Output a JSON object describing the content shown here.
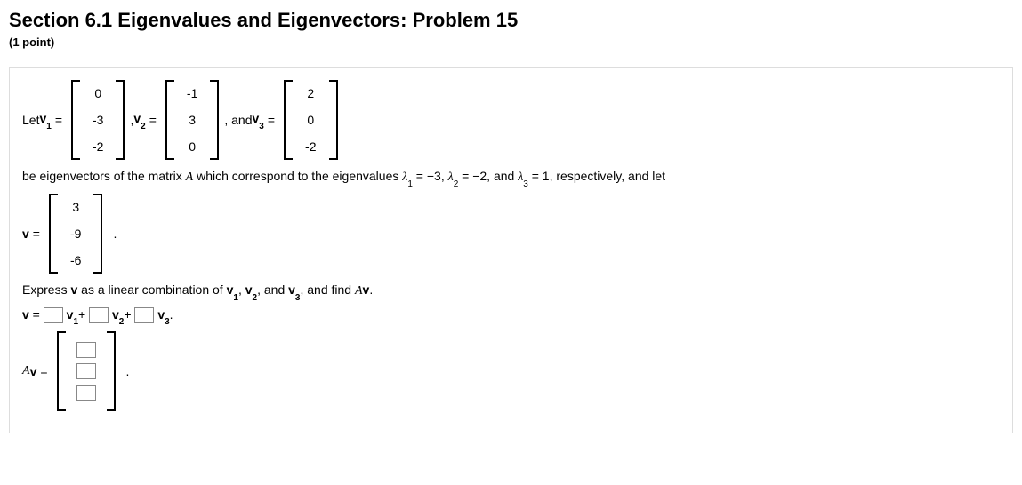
{
  "header": {
    "title": "Section 6.1 Eigenvalues and Eigenvectors: Problem 15",
    "points": "(1 point)"
  },
  "labels": {
    "let": "Let ",
    "v1": "v",
    "v1sub": "1",
    "eq": " = ",
    "comma_v2": ", ",
    "v2": "v",
    "v2sub": "2",
    "and_v3": ", and ",
    "v3": "v",
    "v3sub": "3",
    "sentence2_a": "be eigenvectors of the matrix ",
    "A": "A",
    "sentence2_b": " which correspond to the eigenvalues ",
    "lam1": "λ",
    "lam1sub": "1",
    "lam1val": " = −3",
    "lam_sep1": ", ",
    "lam2": "λ",
    "lam2sub": "2",
    "lam2val": " = −2",
    "lam_sep2": ", and ",
    "lam3": "λ",
    "lam3sub": "3",
    "lam3val": " = 1",
    "sentence2_c": ", respectively, and let",
    "v": "v",
    "period": ".",
    "express_a": "Express ",
    "express_b": " as a linear combination of ",
    "express_c": ", and ",
    "express_d": ", and find ",
    "Av": "Av",
    "plus": "+",
    "dotend": "."
  },
  "vectors": {
    "v1": [
      "0",
      "-3",
      "-2"
    ],
    "v2": [
      "-1",
      "3",
      "0"
    ],
    "v3": [
      "2",
      "0",
      "-2"
    ],
    "v": [
      "3",
      "-9",
      "-6"
    ]
  }
}
